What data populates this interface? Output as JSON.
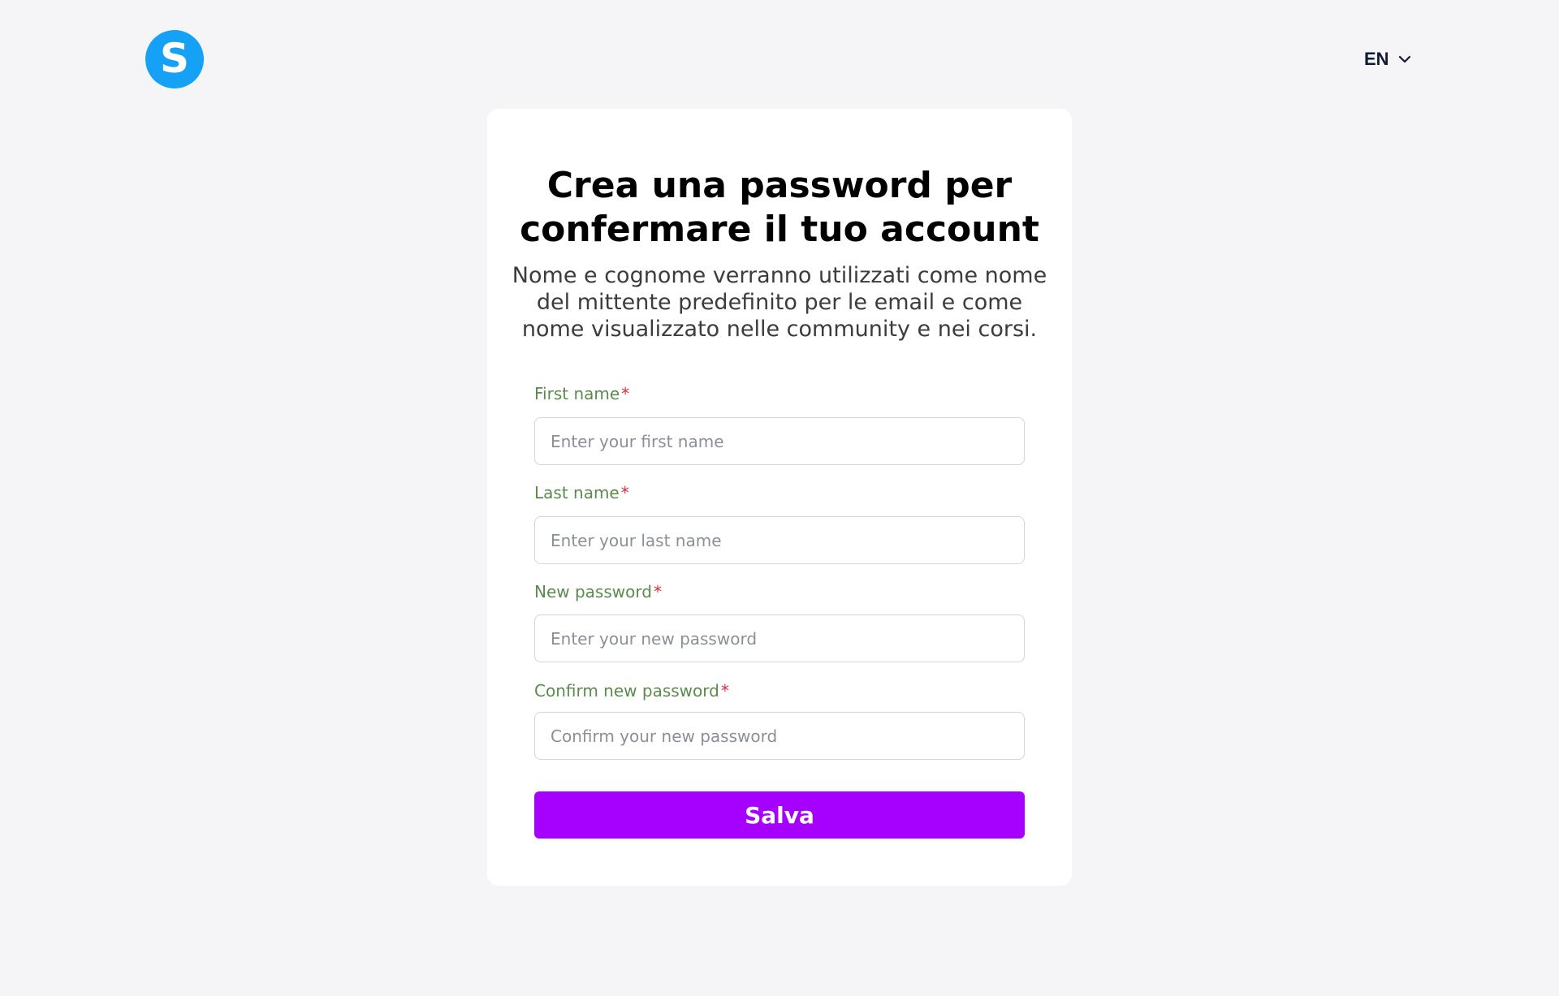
{
  "header": {
    "logo_letter": "S",
    "language": "EN"
  },
  "form": {
    "title": "Crea una password per confermare il tuo account",
    "subtitle": "Nome e cognome verranno utilizzati come nome del mittente predefinito per le email e come nome visualizzato nelle community e nei corsi.",
    "required_mark": "*",
    "fields": [
      {
        "label": "First name",
        "placeholder": "Enter your first name",
        "value": ""
      },
      {
        "label": "Last name",
        "placeholder": "Enter your last name",
        "value": ""
      },
      {
        "label": "New password",
        "placeholder": "Enter your new password",
        "value": ""
      },
      {
        "label": "Confirm new password",
        "placeholder": "Confirm your new password",
        "value": ""
      }
    ],
    "submit_label": "Salva"
  },
  "colors": {
    "page_background": "#f5f5f7",
    "logo": "#15a1f5",
    "label": "#5c8a4e",
    "required": "#e0293b",
    "button": "#a600ff"
  },
  "icons": {
    "logo": "logo-s-icon",
    "language_dropdown": "chevron-down-icon"
  }
}
